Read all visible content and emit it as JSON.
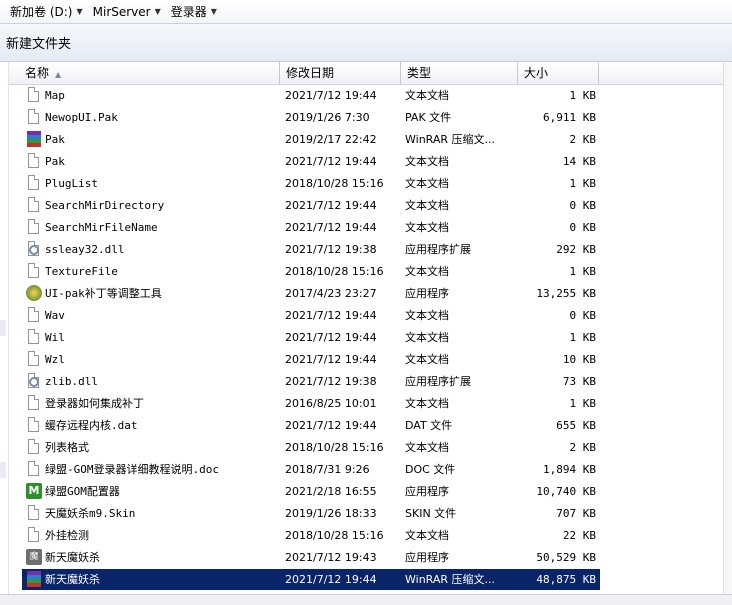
{
  "breadcrumb": [
    {
      "label": "新加卷 (D:)"
    },
    {
      "label": "MirServer"
    },
    {
      "label": "登录器"
    }
  ],
  "toolbar": {
    "new_folder": "新建文件夹"
  },
  "columns": {
    "name": "名称",
    "date": "修改日期",
    "type": "类型",
    "size": "大小"
  },
  "files": [
    {
      "icon": "text-file-icon",
      "name": "Map",
      "date": "2021/7/12 19:44",
      "type": "文本文档",
      "size": "1 KB"
    },
    {
      "icon": "text-file-icon",
      "name": "NewopUI.Pak",
      "date": "2019/1/26 7:30",
      "type": "PAK 文件",
      "size": "6,911 KB"
    },
    {
      "icon": "rar-archive-icon",
      "name": "Pak",
      "date": "2019/2/17 22:42",
      "type": "WinRAR 压缩文...",
      "size": "2 KB"
    },
    {
      "icon": "text-file-icon",
      "name": "Pak",
      "date": "2021/7/12 19:44",
      "type": "文本文档",
      "size": "14 KB"
    },
    {
      "icon": "text-file-icon",
      "name": "PlugList",
      "date": "2018/10/28 15:16",
      "type": "文本文档",
      "size": "1 KB"
    },
    {
      "icon": "text-file-icon",
      "name": "SearchMirDirectory",
      "date": "2021/7/12 19:44",
      "type": "文本文档",
      "size": "0 KB"
    },
    {
      "icon": "text-file-icon",
      "name": "SearchMirFileName",
      "date": "2021/7/12 19:44",
      "type": "文本文档",
      "size": "0 KB"
    },
    {
      "icon": "dll-gear-icon",
      "name": "ssleay32.dll",
      "date": "2021/7/12 19:38",
      "type": "应用程序扩展",
      "size": "292 KB"
    },
    {
      "icon": "text-file-icon",
      "name": "TextureFile",
      "date": "2018/10/28 15:16",
      "type": "文本文档",
      "size": "1 KB"
    },
    {
      "icon": "tool-app-icon",
      "name": "UI-pak补丁等调整工具",
      "date": "2017/4/23 23:27",
      "type": "应用程序",
      "size": "13,255 KB"
    },
    {
      "icon": "text-file-icon",
      "name": "Wav",
      "date": "2021/7/12 19:44",
      "type": "文本文档",
      "size": "0 KB"
    },
    {
      "icon": "text-file-icon",
      "name": "Wil",
      "date": "2021/7/12 19:44",
      "type": "文本文档",
      "size": "1 KB"
    },
    {
      "icon": "text-file-icon",
      "name": "Wzl",
      "date": "2021/7/12 19:44",
      "type": "文本文档",
      "size": "10 KB"
    },
    {
      "icon": "dll-gear-icon",
      "name": "zlib.dll",
      "date": "2021/7/12 19:38",
      "type": "应用程序扩展",
      "size": "73 KB"
    },
    {
      "icon": "text-file-icon",
      "name": "登录器如何集成补丁",
      "date": "2016/8/25 10:01",
      "type": "文本文档",
      "size": "1 KB"
    },
    {
      "icon": "text-file-icon",
      "name": "缓存远程内核.dat",
      "date": "2021/7/12 19:44",
      "type": "DAT 文件",
      "size": "655 KB"
    },
    {
      "icon": "text-file-icon",
      "name": "列表格式",
      "date": "2018/10/28 15:16",
      "type": "文本文档",
      "size": "2 KB"
    },
    {
      "icon": "text-file-icon",
      "name": "绿盟-GOM登录器详细教程说明.doc",
      "date": "2018/7/31 9:26",
      "type": "DOC 文件",
      "size": "1,894 KB"
    },
    {
      "icon": "green-app-icon",
      "name": "绿盟GOM配置器",
      "date": "2021/2/18 16:55",
      "type": "应用程序",
      "size": "10,740 KB"
    },
    {
      "icon": "text-file-icon",
      "name": "天魔妖杀m9.Skin",
      "date": "2019/1/26 18:33",
      "type": "SKIN 文件",
      "size": "707 KB"
    },
    {
      "icon": "text-file-icon",
      "name": "外挂检测",
      "date": "2018/10/28 15:16",
      "type": "文本文档",
      "size": "22 KB"
    },
    {
      "icon": "game-app-icon",
      "name": "新天魔妖杀",
      "date": "2021/7/12 19:43",
      "type": "应用程序",
      "size": "50,529 KB"
    },
    {
      "icon": "rar-archive-icon",
      "name": "新天魔妖杀",
      "date": "2021/7/12 19:44",
      "type": "WinRAR 压缩文...",
      "size": "48,875 KB",
      "selected": true
    }
  ]
}
